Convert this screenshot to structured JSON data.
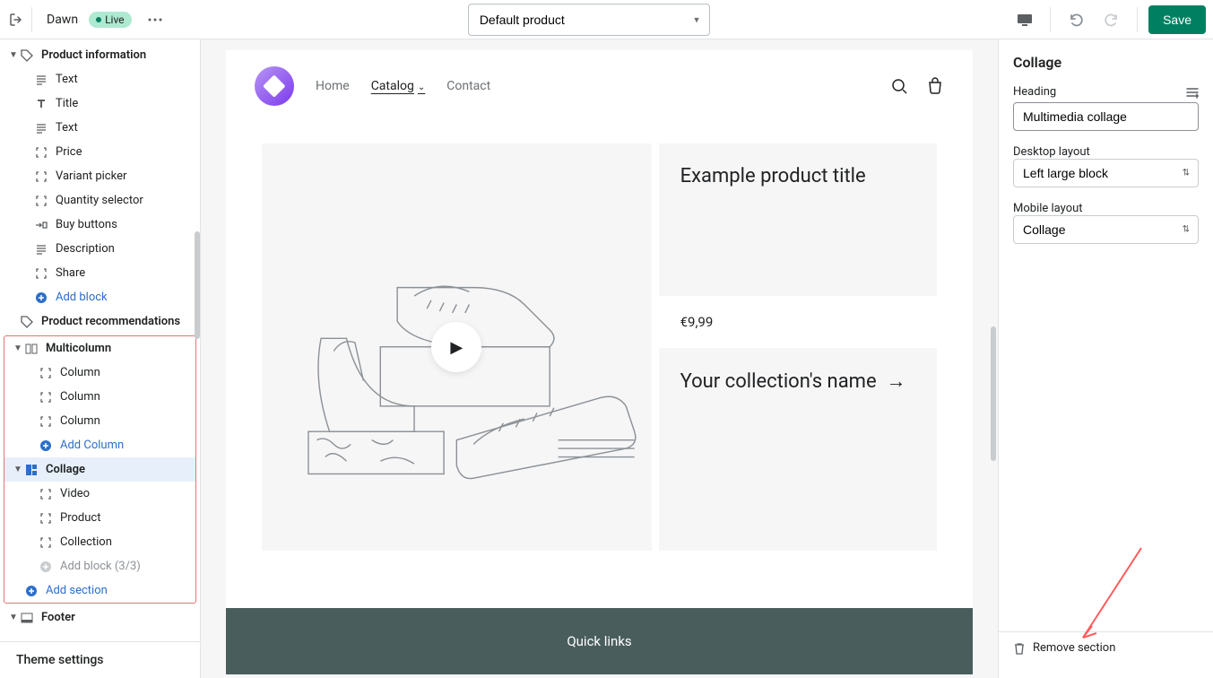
{
  "topbar": {
    "theme_name": "Dawn",
    "live_badge": "Live",
    "page_select": "Default product",
    "save_label": "Save"
  },
  "sidebar_left": {
    "items": [
      {
        "label": "Product information",
        "type": "header",
        "caret": true,
        "icon": "tag"
      },
      {
        "label": "Text",
        "type": "child",
        "icon": "paragraph"
      },
      {
        "label": "Title",
        "type": "child",
        "icon": "title"
      },
      {
        "label": "Text",
        "type": "child",
        "icon": "paragraph"
      },
      {
        "label": "Price",
        "type": "child",
        "icon": "bracket"
      },
      {
        "label": "Variant picker",
        "type": "child",
        "icon": "bracket"
      },
      {
        "label": "Quantity selector",
        "type": "child",
        "icon": "bracket"
      },
      {
        "label": "Buy buttons",
        "type": "child",
        "icon": "buy"
      },
      {
        "label": "Description",
        "type": "child",
        "icon": "paragraph"
      },
      {
        "label": "Share",
        "type": "child",
        "icon": "bracket"
      },
      {
        "label": "Add block",
        "type": "add",
        "icon": "plus"
      },
      {
        "label": "Product recommendations",
        "type": "header_nc",
        "icon": "tag"
      },
      {
        "label": "Multicolumn",
        "type": "header",
        "caret": true,
        "icon": "column",
        "boxed_start": true
      },
      {
        "label": "Column",
        "type": "child",
        "icon": "bracket"
      },
      {
        "label": "Column",
        "type": "child",
        "icon": "bracket"
      },
      {
        "label": "Column",
        "type": "child",
        "icon": "bracket"
      },
      {
        "label": "Add Column",
        "type": "add",
        "icon": "plus"
      },
      {
        "label": "Collage",
        "type": "header",
        "caret": true,
        "icon": "collage",
        "selected": true
      },
      {
        "label": "Video",
        "type": "child",
        "icon": "bracket"
      },
      {
        "label": "Product",
        "type": "child",
        "icon": "bracket"
      },
      {
        "label": "Collection",
        "type": "child",
        "icon": "bracket"
      },
      {
        "label": "Add block (3/3)",
        "type": "add_muted",
        "icon": "plus_muted"
      },
      {
        "label": "Add section",
        "type": "add_section",
        "icon": "plus",
        "boxed_end": true
      },
      {
        "label": "Footer",
        "type": "header",
        "caret": true,
        "icon": "footer"
      }
    ],
    "theme_settings": "Theme settings"
  },
  "preview": {
    "nav": [
      "Home",
      "Catalog",
      "Contact"
    ],
    "nav_active_index": 1,
    "product_title": "Example product title",
    "product_price": "€9,99",
    "collection_title": "Your collection's name",
    "footer_title": "Quick links"
  },
  "sidebar_right": {
    "title": "Collage",
    "heading_label": "Heading",
    "heading_value": "Multimedia collage",
    "desktop_label": "Desktop layout",
    "desktop_value": "Left large block",
    "mobile_label": "Mobile layout",
    "mobile_value": "Collage",
    "remove_label": "Remove section"
  }
}
